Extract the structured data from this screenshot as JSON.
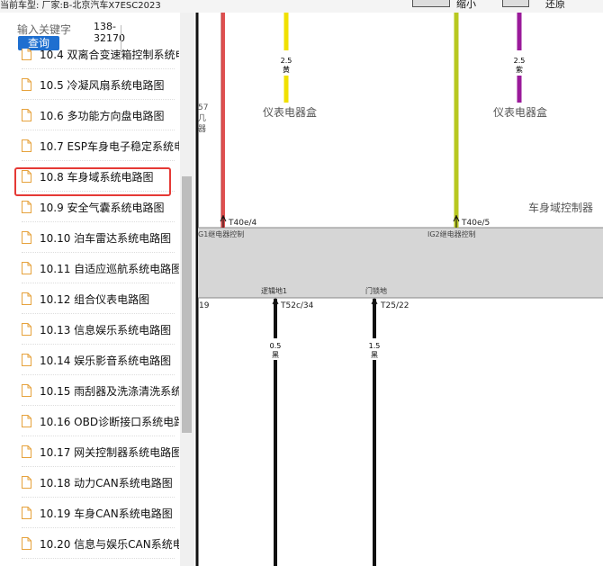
{
  "topbar": {
    "vehicle_text": "当前车型:   厂家:B-北京汽车X7ESC2023",
    "btn1_label": "缩小",
    "btn2_label": "还原"
  },
  "search": {
    "placeholder": "输入关键字",
    "button_label": "查询",
    "phone_line1": "138-",
    "phone_line2": "32170"
  },
  "tree": {
    "items": [
      {
        "label": "10.4 双离合变速箱控制系统电路图"
      },
      {
        "label": "10.5 冷凝风扇系统电路图"
      },
      {
        "label": "10.6 多功能方向盘电路图"
      },
      {
        "label": "10.7 ESP车身电子稳定系统电路图"
      },
      {
        "label": "10.8 车身域系统电路图"
      },
      {
        "label": "10.9 安全气囊系统电路图"
      },
      {
        "label": "10.10 泊车雷达系统电路图"
      },
      {
        "label": "10.11 自适应巡航系统电路图"
      },
      {
        "label": "10.12 组合仪表电路图"
      },
      {
        "label": "10.13 信息娱乐系统电路图"
      },
      {
        "label": "10.14 娱乐影音系统电路图"
      },
      {
        "label": "10.15 雨刮器及洗涤清洗系统电路图"
      },
      {
        "label": "10.16 OBD诊断接口系统电路图"
      },
      {
        "label": "10.17 网关控制器系统电路图"
      },
      {
        "label": "10.18 动力CAN系统电路图"
      },
      {
        "label": "10.19 车身CAN系统电路图"
      },
      {
        "label": "10.20 信息与娱乐CAN系统电路图"
      }
    ]
  },
  "diagram": {
    "colors": {
      "red": "#e05050",
      "yellow": "#f0e000",
      "yellowgreen": "#b8c820",
      "purple": "#9a1a9a",
      "black": "#111111",
      "band": "#d6d6d6"
    },
    "wire_yellow_size": "2.5",
    "wire_yellow_color": "黄",
    "wire_purple_size": "2.5",
    "wire_purple_color": "紫",
    "box_left": "仪表电器盒",
    "box_right": "仪表电器盒",
    "left_edge_num": "57",
    "left_edge_c1": "几",
    "left_edge_c2": "器",
    "pin1": "T40e/4",
    "pin2": "T40e/5",
    "controller": "车身域控制器",
    "relay1": "G1继电器控制",
    "relay2": "IG2继电器控制",
    "ground_logic": "逻辑地1",
    "ground_door": "门锁地",
    "left_edge_19": "19",
    "pin3": "T52c/34",
    "pin4": "T25/22",
    "wire3_size": "0.5",
    "wire3_color": "黑",
    "wire4_size": "1.5",
    "wire4_color": "黑"
  }
}
